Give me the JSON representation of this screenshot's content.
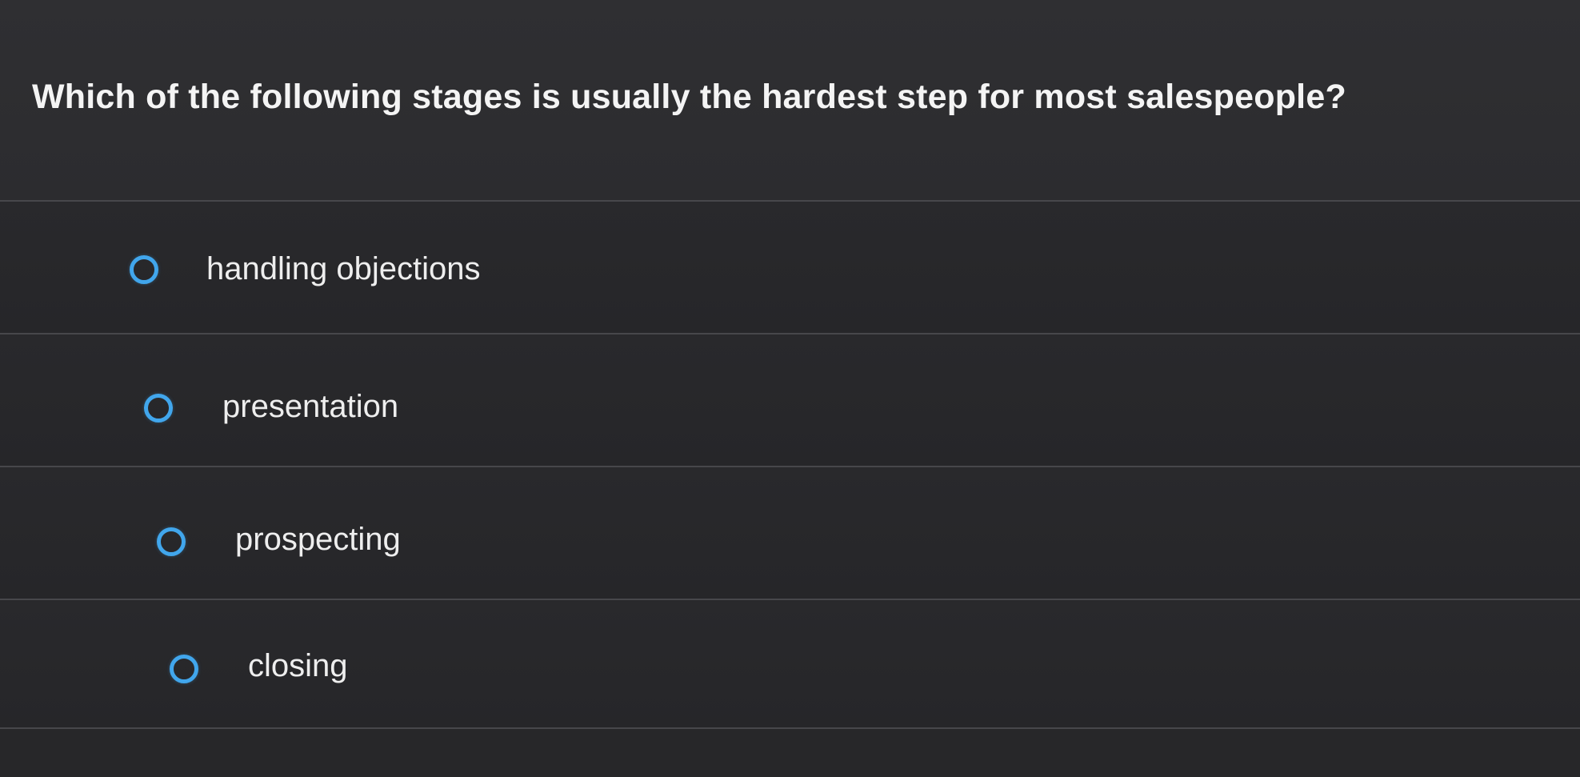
{
  "question": {
    "text": "Which of the following stages is usually the hardest step for most salespeople?"
  },
  "options": [
    {
      "label": "handling objections",
      "selected": false
    },
    {
      "label": "presentation",
      "selected": false
    },
    {
      "label": "prospecting",
      "selected": false
    },
    {
      "label": "closing",
      "selected": false
    }
  ],
  "colors": {
    "radio_accent": "#41a6ec",
    "background": "#2a2a2c",
    "text": "#f4f4f4"
  }
}
